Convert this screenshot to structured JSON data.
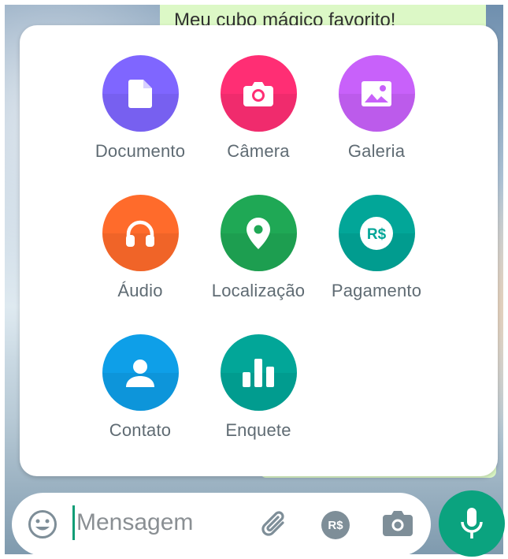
{
  "chat": {
    "message_text": "Meu cubo mágico favorito!"
  },
  "attach_menu": {
    "items": [
      {
        "label": "Documento",
        "icon": "document-icon",
        "color": "#7f66ff"
      },
      {
        "label": "Câmera",
        "icon": "camera-icon",
        "color": "#ff2e74"
      },
      {
        "label": "Galeria",
        "icon": "gallery-icon",
        "color": "#c861fa"
      },
      {
        "label": "Áudio",
        "icon": "headphones-icon",
        "color": "#ff6b2b"
      },
      {
        "label": "Localização",
        "icon": "location-pin-icon",
        "color": "#1fa855"
      },
      {
        "label": "Pagamento",
        "icon": "payment-icon",
        "color": "#02a698"
      },
      {
        "label": "Contato",
        "icon": "contact-icon",
        "color": "#0e9fe8"
      },
      {
        "label": "Enquete",
        "icon": "poll-icon",
        "color": "#02a698"
      }
    ]
  },
  "composer": {
    "placeholder": "Mensagem",
    "payment_badge": "R$"
  },
  "colors": {
    "accent": "#0ba37f",
    "label_text": "#5f6b73"
  }
}
